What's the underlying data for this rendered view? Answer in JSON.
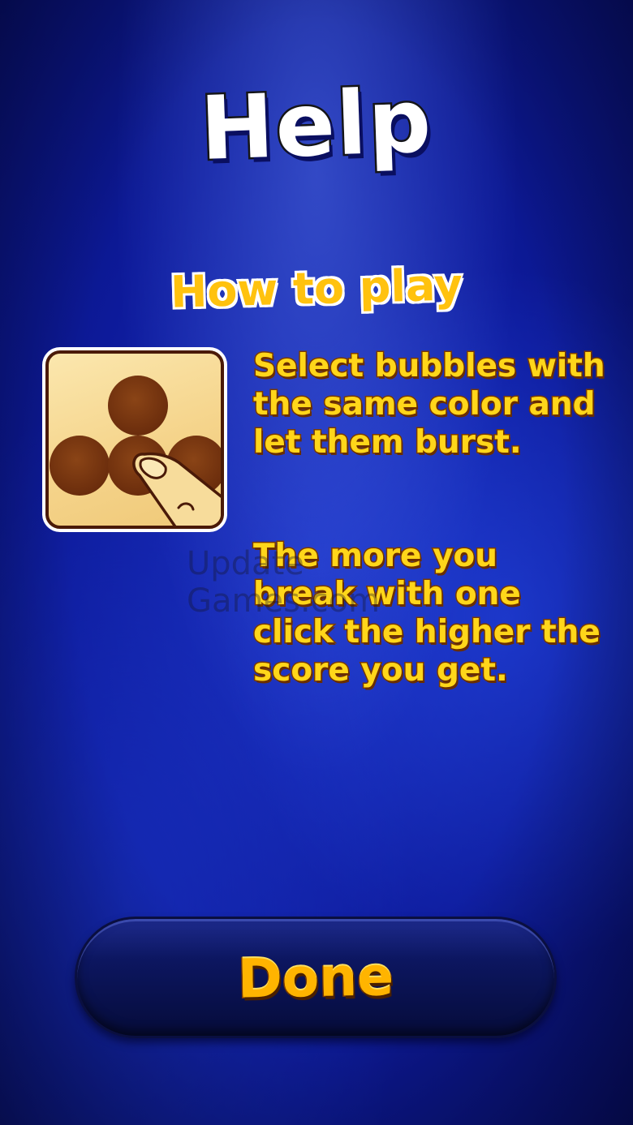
{
  "screen": {
    "title": "Help",
    "subtitle": "How to play"
  },
  "instructions": {
    "paragraph1": "Select bubbles with the same color and let them burst.",
    "paragraph2": "The more you break with one click the higher the score you get."
  },
  "tile": {
    "icon": "bubbles-finger-tap-icon",
    "bubble_color": "#7a3a12",
    "background_color": "#f5d48b"
  },
  "watermark": "Update Games.com",
  "done_button": {
    "label": "Done"
  },
  "colors": {
    "background": "#0d1a9a",
    "text_yellow": "#ffd61a",
    "button_label": "#ffb400"
  }
}
